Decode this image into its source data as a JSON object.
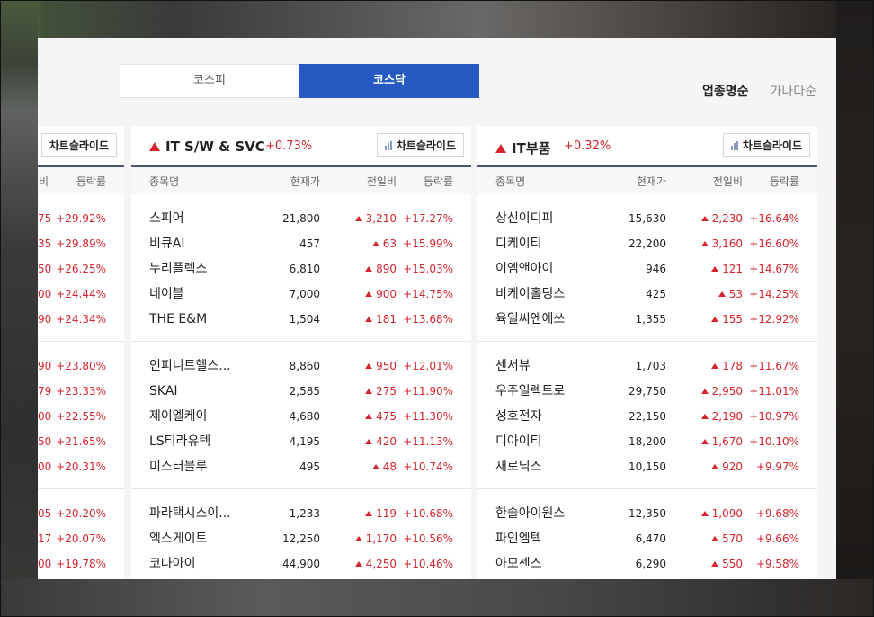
{
  "market_tabs": [
    {
      "label": "코스피",
      "active": false
    },
    {
      "label": "코스닥",
      "active": true
    }
  ],
  "sort_options": [
    {
      "label": "업종명순",
      "active": true
    },
    {
      "label": "가나다순",
      "active": false
    }
  ],
  "chart_slide_label": "차트슬라이드",
  "columns": {
    "name": "종목명",
    "price": "현재가",
    "change": "전일비",
    "rate": "등락률"
  },
  "left_partial": {
    "columns": {
      "change_partial": "비",
      "rate": "등락률"
    },
    "groups": [
      [
        {
          "change": "75",
          "rate": "+29.92%"
        },
        {
          "change": "35",
          "rate": "+29.89%"
        },
        {
          "change": "50",
          "rate": "+26.25%"
        },
        {
          "change": "00",
          "rate": "+24.44%"
        },
        {
          "change": "90",
          "rate": "+24.34%"
        }
      ],
      [
        {
          "change": "90",
          "rate": "+23.80%"
        },
        {
          "change": "79",
          "rate": "+23.33%"
        },
        {
          "change": "00",
          "rate": "+22.55%"
        },
        {
          "change": "50",
          "rate": "+21.65%"
        },
        {
          "change": "00",
          "rate": "+20.31%"
        }
      ],
      [
        {
          "change": "05",
          "rate": "+20.20%"
        },
        {
          "change": "17",
          "rate": "+20.07%"
        },
        {
          "change": "00",
          "rate": "+19.78%"
        }
      ]
    ]
  },
  "panels": [
    {
      "title": "IT S/W & SVC",
      "change": "+0.73%",
      "groups": [
        [
          {
            "name": "스피어",
            "price": "21,800",
            "change": "3,210",
            "rate": "+17.27%"
          },
          {
            "name": "비큐AI",
            "price": "457",
            "change": "63",
            "rate": "+15.99%"
          },
          {
            "name": "누리플렉스",
            "price": "6,810",
            "change": "890",
            "rate": "+15.03%"
          },
          {
            "name": "네이블",
            "price": "7,000",
            "change": "900",
            "rate": "+14.75%"
          },
          {
            "name": "THE E&M",
            "price": "1,504",
            "change": "181",
            "rate": "+13.68%"
          }
        ],
        [
          {
            "name": "인피니트헬스...",
            "price": "8,860",
            "change": "950",
            "rate": "+12.01%"
          },
          {
            "name": "SKAI",
            "price": "2,585",
            "change": "275",
            "rate": "+11.90%"
          },
          {
            "name": "제이엘케이",
            "price": "4,680",
            "change": "475",
            "rate": "+11.30%"
          },
          {
            "name": "LS티라유텍",
            "price": "4,195",
            "change": "420",
            "rate": "+11.13%"
          },
          {
            "name": "미스터블루",
            "price": "495",
            "change": "48",
            "rate": "+10.74%"
          }
        ],
        [
          {
            "name": "파라택시스이...",
            "price": "1,233",
            "change": "119",
            "rate": "+10.68%"
          },
          {
            "name": "엑스게이트",
            "price": "12,250",
            "change": "1,170",
            "rate": "+10.56%"
          },
          {
            "name": "코나아이",
            "price": "44,900",
            "change": "4,250",
            "rate": "+10.46%"
          }
        ]
      ]
    },
    {
      "title": "IT부품",
      "change": "+0.32%",
      "groups": [
        [
          {
            "name": "상신이디피",
            "price": "15,630",
            "change": "2,230",
            "rate": "+16.64%"
          },
          {
            "name": "디케이티",
            "price": "22,200",
            "change": "3,160",
            "rate": "+16.60%"
          },
          {
            "name": "이엠앤아이",
            "price": "946",
            "change": "121",
            "rate": "+14.67%"
          },
          {
            "name": "비케이홀딩스",
            "price": "425",
            "change": "53",
            "rate": "+14.25%"
          },
          {
            "name": "육일씨엔에쓰",
            "price": "1,355",
            "change": "155",
            "rate": "+12.92%"
          }
        ],
        [
          {
            "name": "센서뷰",
            "price": "1,703",
            "change": "178",
            "rate": "+11.67%"
          },
          {
            "name": "우주일렉트로",
            "price": "29,750",
            "change": "2,950",
            "rate": "+11.01%"
          },
          {
            "name": "성호전자",
            "price": "22,150",
            "change": "2,190",
            "rate": "+10.97%"
          },
          {
            "name": "디아이티",
            "price": "18,200",
            "change": "1,670",
            "rate": "+10.10%"
          },
          {
            "name": "새로닉스",
            "price": "10,150",
            "change": "920",
            "rate": "+9.97%"
          }
        ],
        [
          {
            "name": "한솔아이원스",
            "price": "12,350",
            "change": "1,090",
            "rate": "+9.68%"
          },
          {
            "name": "파인엠텍",
            "price": "6,470",
            "change": "570",
            "rate": "+9.66%"
          },
          {
            "name": "아모센스",
            "price": "6,290",
            "change": "550",
            "rate": "+9.58%"
          }
        ]
      ]
    }
  ]
}
